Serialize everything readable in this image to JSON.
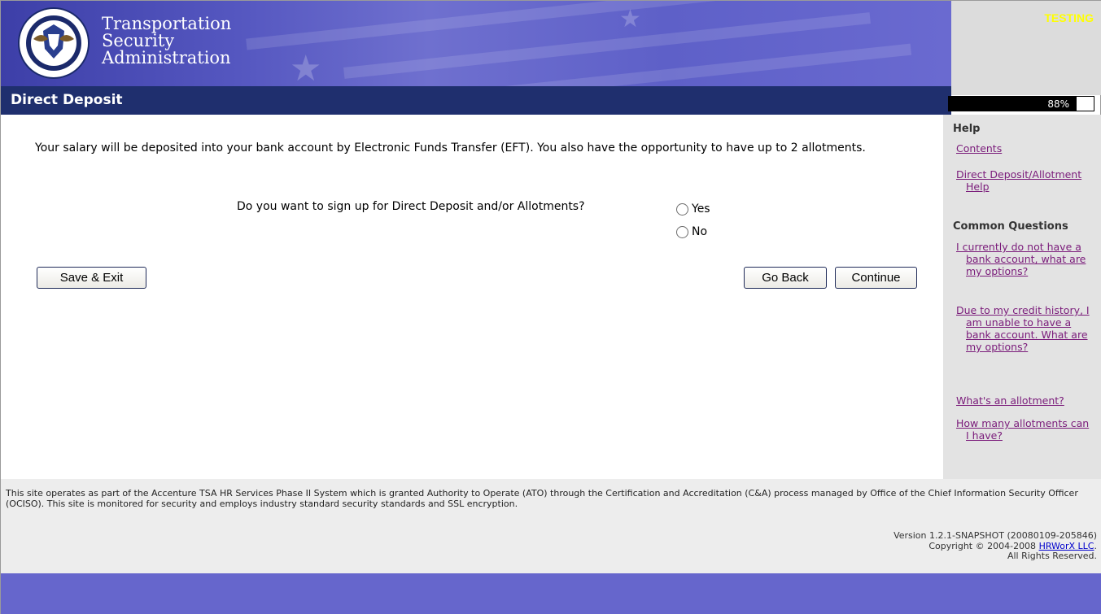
{
  "header": {
    "agency_lines": [
      "Transportation",
      "Security",
      "Administration"
    ],
    "env_badge": "TESTING"
  },
  "title_bar": {
    "title": "Direct Deposit"
  },
  "progress": {
    "percent": 88,
    "label": "88%"
  },
  "main": {
    "intro": "Your salary will be deposited into your bank account by Electronic Funds Transfer (EFT). You also have the opportunity to have up to 2 allotments.",
    "question": "Do you want to sign up for Direct Deposit and/or Allotments?",
    "options": [
      {
        "label": "Yes",
        "selected": false
      },
      {
        "label": "No",
        "selected": false
      }
    ],
    "buttons": {
      "save_exit": "Save & Exit",
      "go_back": "Go Back",
      "continue": "Continue"
    }
  },
  "sidebar": {
    "help_heading": "Help",
    "help_links": [
      "Contents",
      "Direct Deposit/Allotment Help"
    ],
    "questions_heading": "Common Questions",
    "question_links": [
      "I currently do not have a bank account, what are my options?",
      "Due to my credit history, I am unable to have a bank account. What are my options?",
      "What's an allotment?",
      "How many allotments can I have?"
    ]
  },
  "footer": {
    "disclaimer": "This site operates as part of the Accenture TSA HR Services Phase II System which is granted Authority to Operate (ATO) through the Certification and Accreditation (C&A) process managed by Office of the Chief Information Security Officer (OCISO). This site is monitored for security and employs industry standard security standards and SSL encryption.",
    "version": "Version 1.2.1-SNAPSHOT (20080109-205846)",
    "copyright_prefix": "Copyright © 2004-2008 ",
    "company_link": "HRWorX LLC",
    "copyright_suffix": ".",
    "rights": "All Rights Reserved."
  },
  "colors": {
    "header_blue": "#5557c0",
    "title_bar": "#1f2f6e",
    "link_visited": "#7a1b7a",
    "env_badge": "#ffff00",
    "bottom_bar": "#6666cc"
  }
}
